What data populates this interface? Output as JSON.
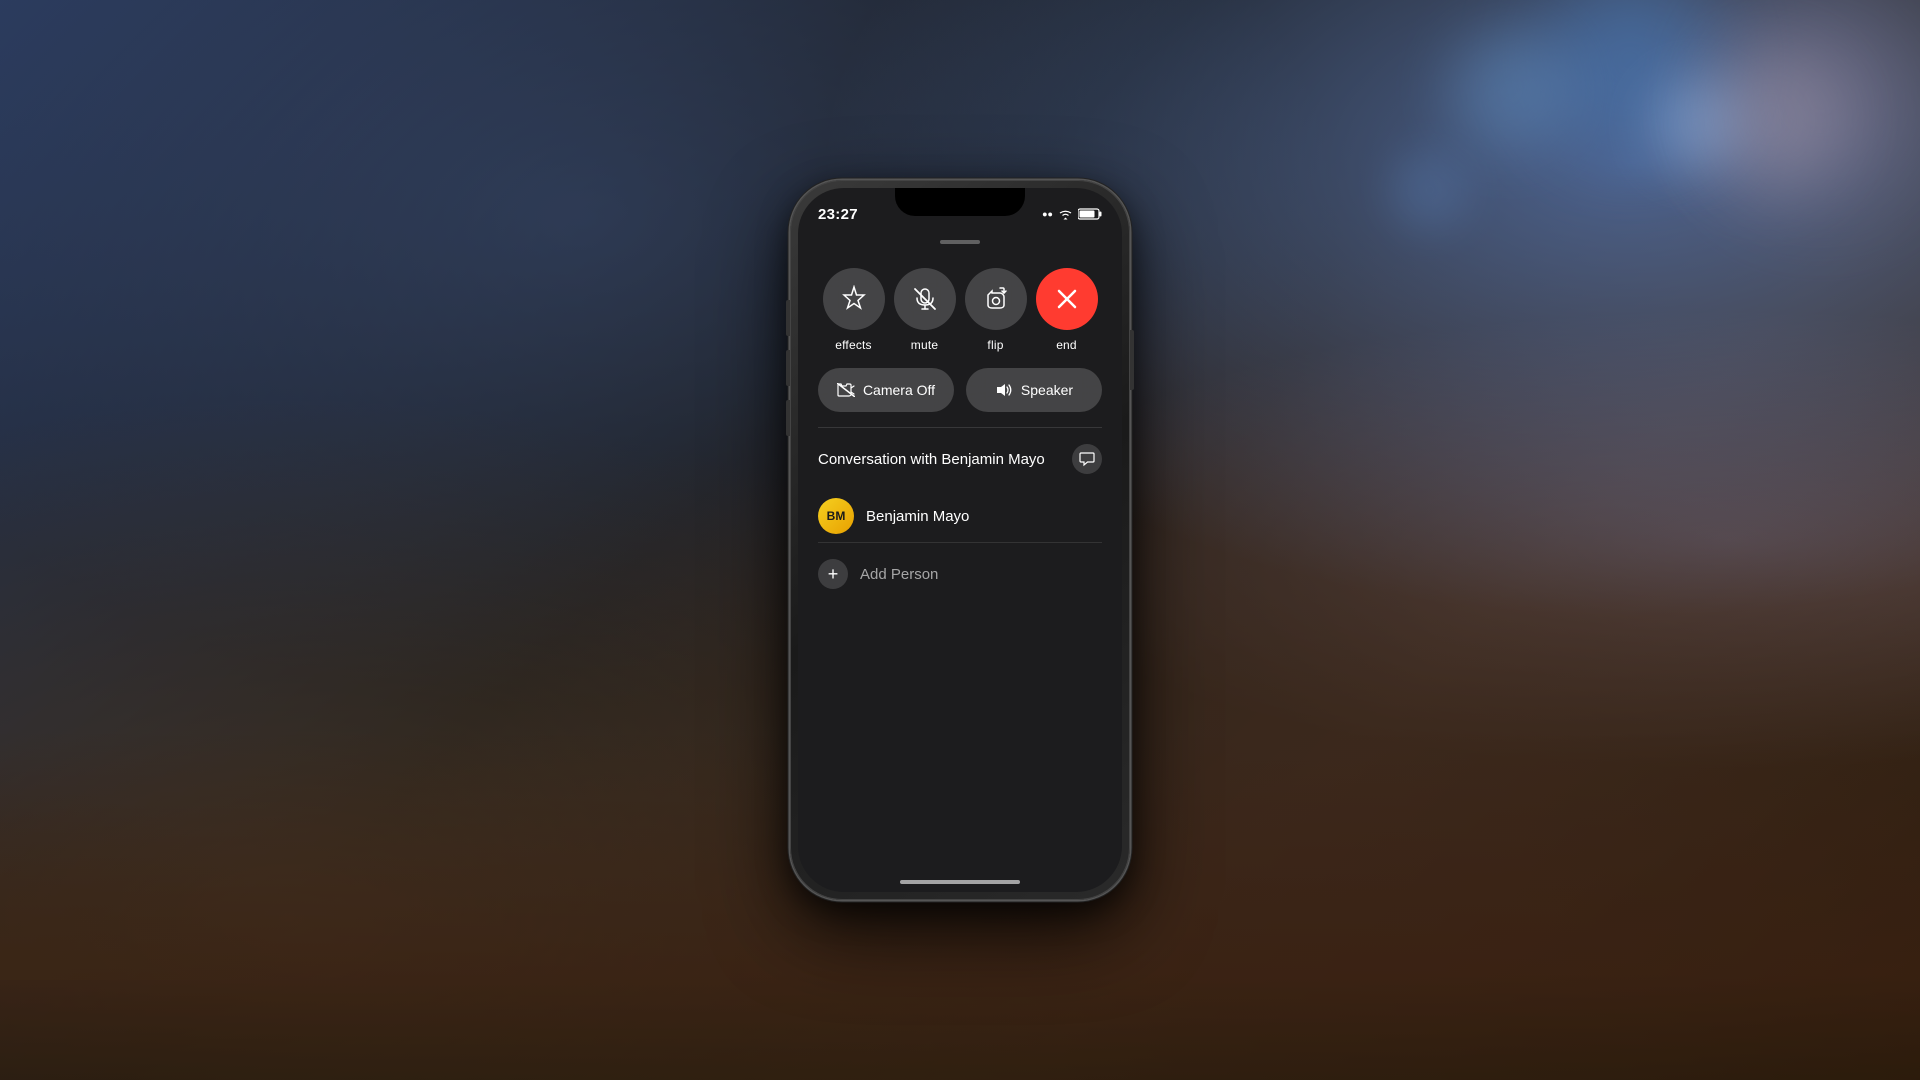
{
  "background": {
    "description": "blurred bokeh background with blue, brown, desk tones"
  },
  "statusBar": {
    "time": "23:27",
    "signal": "●●",
    "wifi": "WiFi",
    "battery": "Battery"
  },
  "callControls": {
    "buttons": [
      {
        "id": "effects",
        "label": "effects",
        "icon": "star"
      },
      {
        "id": "mute",
        "label": "mute",
        "icon": "mic-off"
      },
      {
        "id": "flip",
        "label": "flip",
        "icon": "camera-flip"
      },
      {
        "id": "end",
        "label": "end",
        "icon": "x",
        "variant": "red"
      }
    ],
    "secondaryButtons": [
      {
        "id": "camera-off",
        "label": "Camera Off",
        "icon": "camera-slash"
      },
      {
        "id": "speaker",
        "label": "Speaker",
        "icon": "speaker"
      }
    ]
  },
  "conversation": {
    "title": "Conversation with Benjamin Mayo",
    "messageIconLabel": "Message",
    "contacts": [
      {
        "name": "Benjamin Mayo",
        "initials": "BM",
        "avatarColors": [
          "#f5d020",
          "#e8a000"
        ]
      }
    ],
    "addPersonLabel": "Add Person"
  },
  "homeIndicator": {
    "visible": true
  }
}
